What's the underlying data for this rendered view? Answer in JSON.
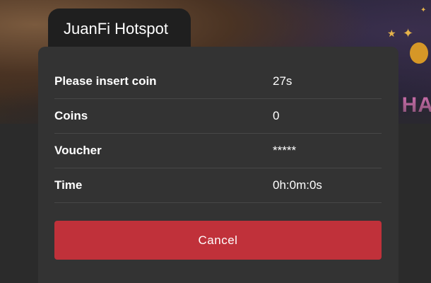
{
  "header": {
    "app_title": "JuanFi Hotspot",
    "banner_text": "HA"
  },
  "status": {
    "rows": [
      {
        "label": "Please insert coin",
        "value": "27s"
      },
      {
        "label": "Coins",
        "value": "0"
      },
      {
        "label": "Voucher",
        "value": "*****"
      },
      {
        "label": "Time",
        "value": "0h:0m:0s"
      }
    ]
  },
  "actions": {
    "cancel_label": "Cancel"
  },
  "colors": {
    "background": "#2b2b2b",
    "card": "#333333",
    "title_tab": "#1f1f1f",
    "cancel_button": "#c0313a",
    "text": "#ffffff"
  }
}
